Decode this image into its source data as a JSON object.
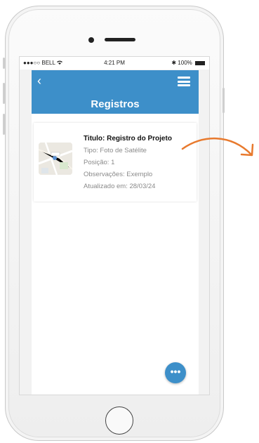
{
  "status_bar": {
    "carrier": "●●●○○ BELL",
    "time": "4:21 PM",
    "battery": "100%"
  },
  "header": {
    "title": "Registros"
  },
  "record": {
    "title": "Titulo: Registro do Projeto",
    "type": "Tipo: Foto de Satélite",
    "position": "Posição: 1",
    "notes": "Observações: Exemplo",
    "updated": "Atualizado em: 28/03/24"
  },
  "icons": {
    "back": "chevron-left-icon",
    "menu": "hamburger-menu-icon",
    "fab": "more-horizontal-icon",
    "annotation": "curved-arrow-icon"
  },
  "colors": {
    "primary": "#3d8fc9",
    "annotation_arrow": "#e87a2e"
  }
}
